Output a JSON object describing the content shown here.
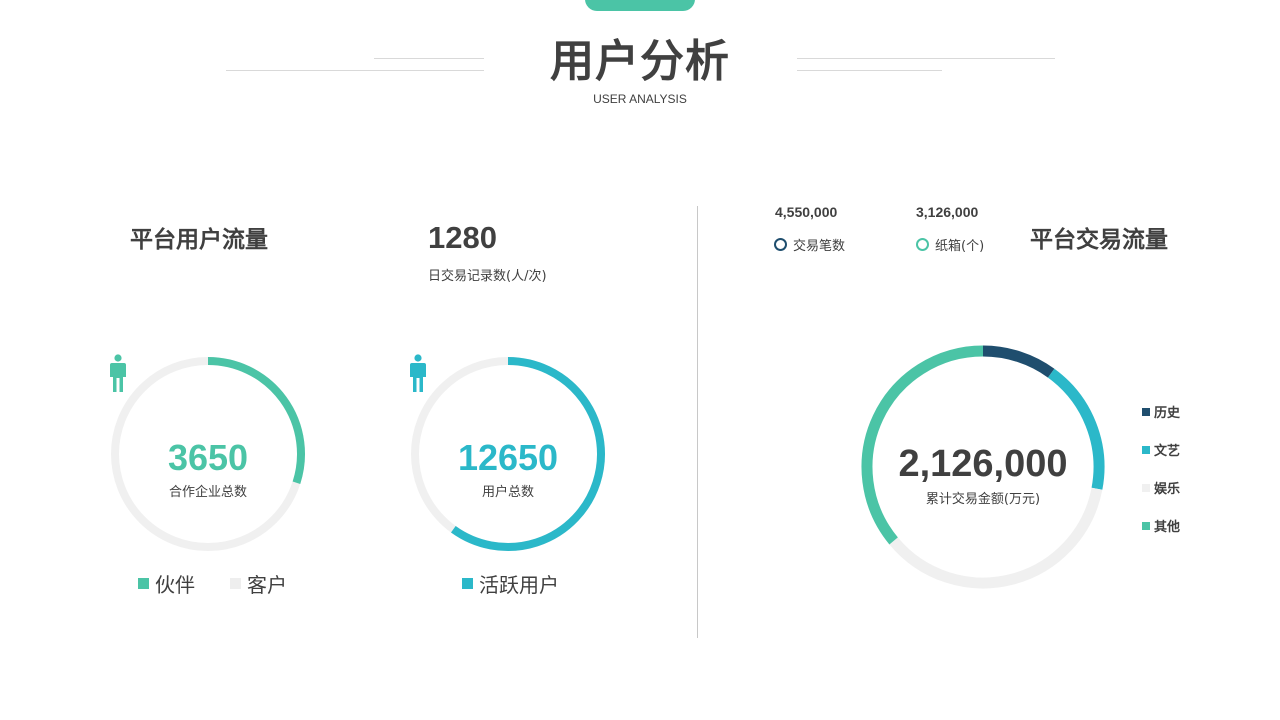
{
  "header": {
    "title": "用户分析",
    "subtitle": "USER ANALYSIS"
  },
  "colors": {
    "teal": "#4bc4a6",
    "cyan": "#2bb8c9",
    "navy": "#1f4e6e",
    "track": "#f0f0f0",
    "text": "#404040",
    "legend_grey": "#eeeeee"
  },
  "left_panel": {
    "title": "平台用户流量",
    "daily_value": "1280",
    "daily_label": "日交易记录数(人/次)",
    "person_icon": "person-icon",
    "ring1": {
      "value": "3650",
      "label": "合作企业总数",
      "color": "#4bc4a6",
      "fill_fraction": 0.3
    },
    "ring2": {
      "value": "12650",
      "label": "用户总数",
      "color": "#2bb8c9",
      "fill_fraction": 0.6
    },
    "legend1": [
      {
        "label": "伙伴",
        "color": "#4bc4a6"
      },
      {
        "label": "客户",
        "color": "#eeeeee"
      }
    ],
    "legend2": [
      {
        "label": "活跃用户",
        "color": "#2bb8c9"
      }
    ]
  },
  "right_panel": {
    "title": "平台交易流量",
    "stats": [
      {
        "value": "4,550,000",
        "label": "交易笔数",
        "color": "#1f4e6e"
      },
      {
        "value": "3,126,000",
        "label": "纸箱(个)",
        "color": "#4bc4a6"
      }
    ],
    "center_value": "2,126,000",
    "center_label": "累计交易金额(万元)"
  },
  "chart_data": [
    {
      "type": "pie",
      "variant": "donut",
      "categories": [
        "伙伴",
        "客户"
      ],
      "values": [
        30,
        70
      ],
      "center_value": 3650,
      "center_label": "合作企业总数"
    },
    {
      "type": "pie",
      "variant": "donut",
      "categories": [
        "活跃用户",
        ""
      ],
      "values": [
        60,
        40
      ],
      "center_value": 12650,
      "center_label": "用户总数"
    },
    {
      "type": "pie",
      "variant": "donut",
      "categories": [
        "历史",
        "文艺",
        "娱乐",
        "其他"
      ],
      "values": [
        10,
        18,
        36,
        36
      ],
      "colors": [
        "#1f4e6e",
        "#2bb8c9",
        "#f0f0f0",
        "#4bc4a6"
      ],
      "center_value": 2126000,
      "center_label": "累计交易金额(万元)",
      "legend_position": "right"
    }
  ]
}
